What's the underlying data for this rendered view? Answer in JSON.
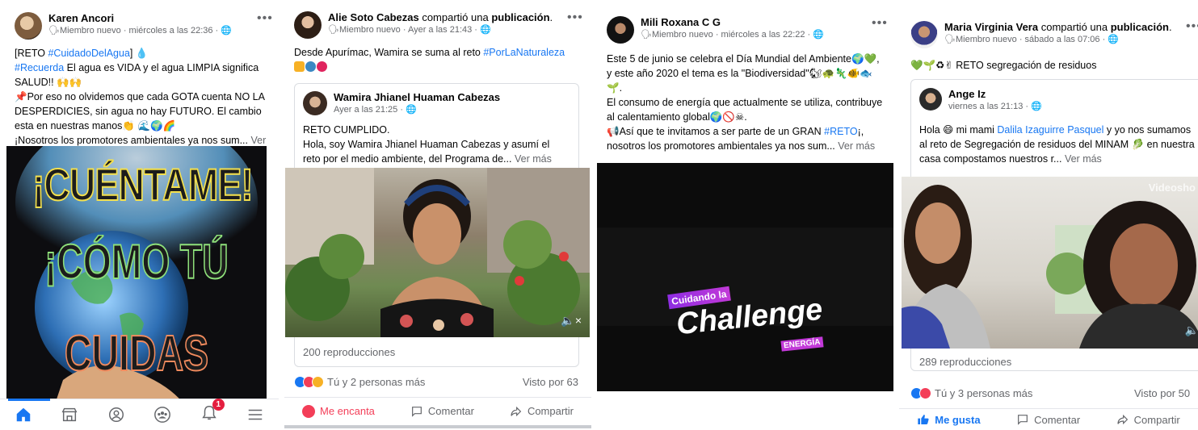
{
  "post1": {
    "author": "Karen Ancori",
    "meta": "Miembro nuevo · miércoles a las 22:36 · ",
    "line1_pre": "[RETO ",
    "line1_tag": "#CuidadoDelAgua",
    "line1_post": "] 💧",
    "line2_tag": "#Recuerda",
    "line2_post": " El agua es VIDA y el agua LIMPIA significa SALUD!! 🙌🙌",
    "line3": "📌Por eso no olvidemos que cada GOTA cuenta NO LA DESPERDICIES, sin agua no hay FUTURO. El cambio esta en nuestras manos👏 🌊🌍🌈",
    "line4": "¡Nosotros los promotores ambientales ya nos sum...",
    "more": "Ver más",
    "image_line1": "¡CUÉNTAME!",
    "image_line2": "¡CÓMO TÚ",
    "image_line3": "CUIDAS",
    "nav": [
      "home-icon",
      "marketplace-icon",
      "profile-icon",
      "groups-icon",
      "notifications-icon",
      "menu-icon"
    ],
    "notification_count": "1"
  },
  "post2": {
    "author": "Alie Soto Cabezas",
    "shared_text": " compartió una ",
    "shared_bold": "publicación",
    "shared_end": ".",
    "meta": "Miembro nuevo · Ayer a las 21:43 · ",
    "text_pre": "Desde Apurímac, Wamira se suma al reto ",
    "text_tag": "#PorLaNaturaleza",
    "inner_author": "Wamira Jhianel Huaman Cabezas",
    "inner_meta": "Ayer a las 21:25 · ",
    "inner_line1": "RETO CUMPLIDO.",
    "inner_line2": "Hola, soy Wamira Jhianel Huaman Cabezas y asumí el reto por el medio ambiente, del Programa de...",
    "more": "Ver más",
    "views": "200 reproducciones",
    "reactions": "Tú y 2 personas más",
    "seen": "Visto por 63",
    "action_love": "Me encanta",
    "action_comment": "Comentar",
    "action_share": "Compartir"
  },
  "post3": {
    "author": "Mili Roxana C G",
    "meta": "Miembro nuevo · miércoles a las 22:22 · ",
    "line1": "Este 5 de junio se celebra el Día Mundial del Ambiente🌍💚, y este año 2020 el tema es la \"Biodiversidad\"🐿🐢🦎🐠🐟🌱.",
    "line2": "El consumo de energía que actualmente se utiliza, contribuye al calentamiento global🌍🚫☠.",
    "line3_pre": "📢Así que te invitamos a ser parte de un GRAN ",
    "line3_tag": "#RETO",
    "line3_post": "¡, nosotros los promotores ambientales ya nos sum...",
    "more": "Ver más",
    "video_tag": "Cuidando la",
    "video_title": "Challenge",
    "video_sub": "ENERGÍA"
  },
  "post4": {
    "author": "Maria Virginia Vera",
    "shared_text": " compartió una ",
    "shared_bold": "publicación",
    "shared_end": ".",
    "meta": "Miembro nuevo · sábado a las 07:06 · ",
    "text": "💚🌱♻✌ RETO segregación de residuos",
    "inner_author": "Ange Iz",
    "inner_meta": "viernes a las 21:13 · ",
    "inner_pre": "Hola 😄 mi mami ",
    "inner_link": "Dalila Izaguirre Pasquel",
    "inner_post": " y yo nos sumamos al reto de Segregación de residuos del MINAM 🥬 en nuestra casa compostamos nuestros r...",
    "more": "Ver más",
    "watermark": "Videosho",
    "views": "289 reproducciones",
    "reactions": "Tú y 3 personas más",
    "seen": "Visto por 50",
    "action_like": "Me gusta",
    "action_comment": "Comentar",
    "action_share": "Compartir"
  },
  "colors": {
    "fb_blue": "#1877f2",
    "love_red": "#f33e58",
    "muted": "#65676b"
  }
}
